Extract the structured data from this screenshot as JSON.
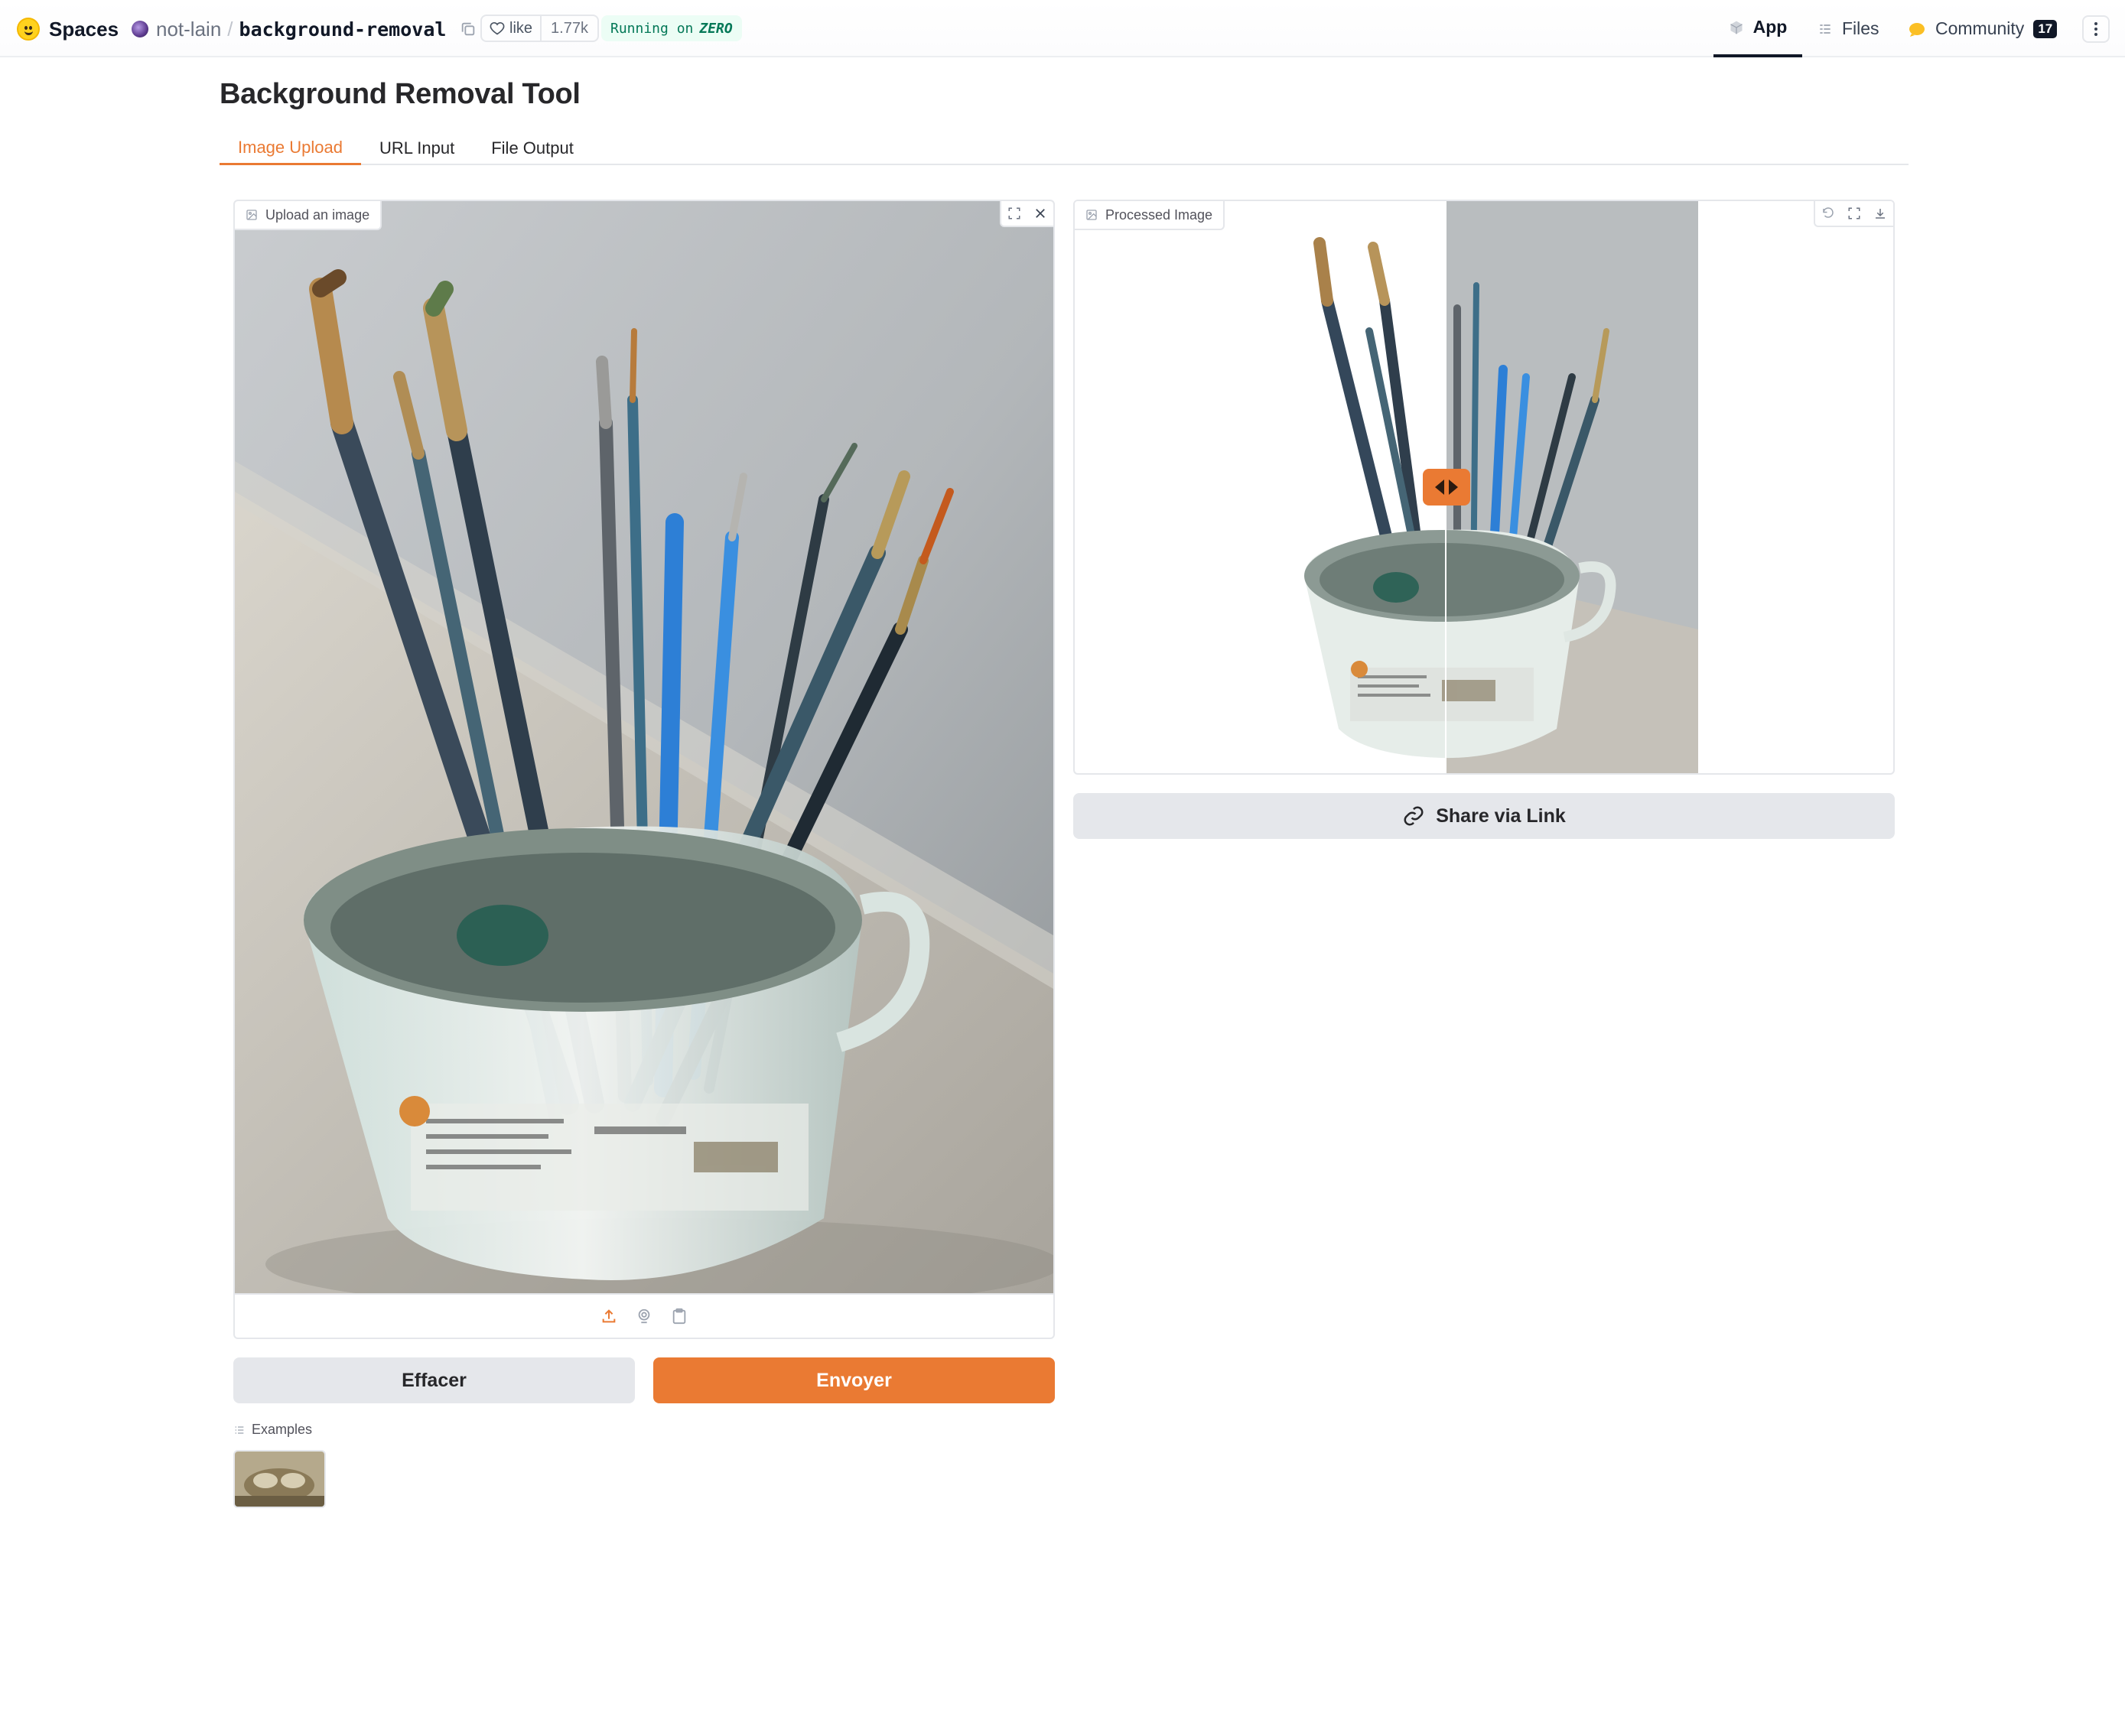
{
  "header": {
    "brand": "Spaces",
    "owner": "not-lain",
    "separator": "/",
    "repo_name": "background-removal",
    "like_label": "like",
    "like_count": "1.77k",
    "running_prefix": "Running on",
    "running_hardware": "ZERO",
    "nav": {
      "app": "App",
      "files": "Files",
      "community": "Community",
      "community_count": "17"
    }
  },
  "page": {
    "title": "Background Removal Tool",
    "tabs": [
      {
        "label": "Image Upload",
        "active": true
      },
      {
        "label": "URL Input",
        "active": false
      },
      {
        "label": "File Output",
        "active": false
      }
    ]
  },
  "upload_panel": {
    "label": "Upload an image",
    "icons": [
      "fullscreen-icon",
      "close-icon",
      "upload-icon",
      "webcam-icon",
      "clipboard-icon"
    ]
  },
  "buttons": {
    "clear": "Effacer",
    "submit": "Envoyer",
    "share": "Share via Link"
  },
  "examples": {
    "label": "Examples"
  },
  "processed_panel": {
    "label": "Processed Image",
    "icons": [
      "undo-icon",
      "fullscreen-icon",
      "download-icon"
    ]
  },
  "colors": {
    "accent": "#ea7a33",
    "running_bg": "#ecfdf5",
    "running_text": "#047857",
    "button_gray": "#e5e7eb"
  }
}
